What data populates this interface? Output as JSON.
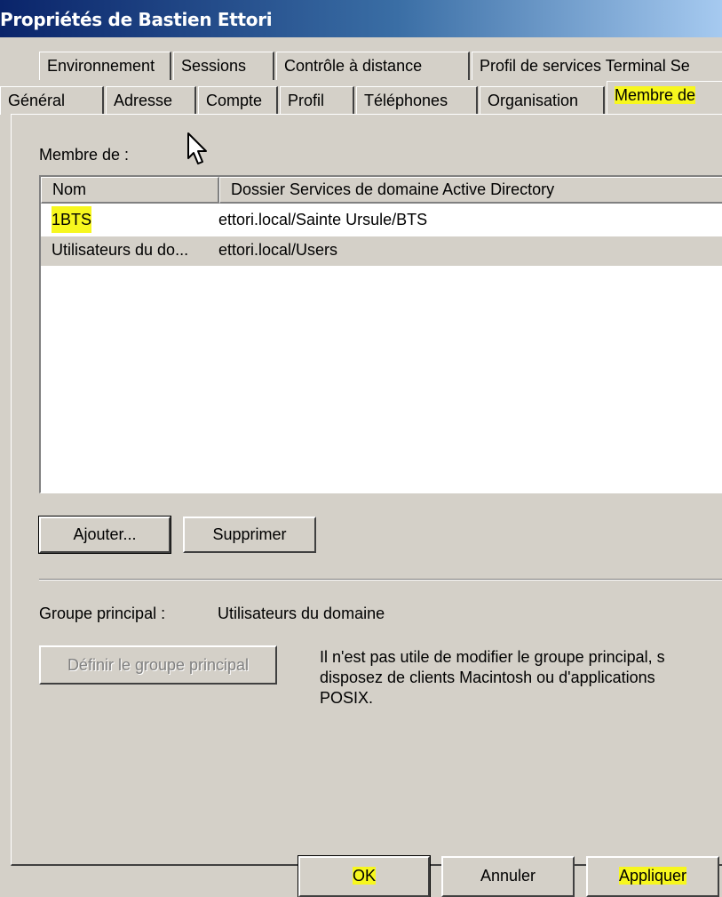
{
  "window": {
    "title": "Propriétés de Bastien Ettori"
  },
  "tabs_row1": [
    {
      "label": "Environnement"
    },
    {
      "label": "Sessions"
    },
    {
      "label": "Contrôle à distance"
    },
    {
      "label": "Profil de services Terminal Se"
    }
  ],
  "tabs_row2": [
    {
      "label": "Général"
    },
    {
      "label": "Adresse"
    },
    {
      "label": "Compte"
    },
    {
      "label": "Profil"
    },
    {
      "label": "Téléphones"
    },
    {
      "label": "Organisation"
    },
    {
      "label": "Membre de",
      "active": true
    }
  ],
  "member_of": {
    "label": "Membre de :",
    "columns": [
      "Nom",
      "Dossier Services de domaine Active Directory"
    ],
    "rows": [
      {
        "name": "1BTS",
        "folder": "ettori.local/Sainte Ursule/BTS"
      },
      {
        "name": "Utilisateurs du do...",
        "folder": "ettori.local/Users"
      }
    ],
    "add_button": "Ajouter...",
    "remove_button": "Supprimer"
  },
  "primary_group": {
    "label": "Groupe principal :",
    "value": "Utilisateurs du domaine",
    "set_button": "Définir le groupe principal",
    "info_lines": [
      "Il n'est pas utile de modifier le groupe principal, s",
      "disposez de clients Macintosh ou d'applications",
      "POSIX."
    ]
  },
  "footer": {
    "ok": "OK",
    "cancel": "Annuler",
    "apply": "Appliquer"
  },
  "colors": {
    "highlight": "#f7f71e",
    "window_bg": "#d4d0c8",
    "titlebar": "#0a246a"
  }
}
